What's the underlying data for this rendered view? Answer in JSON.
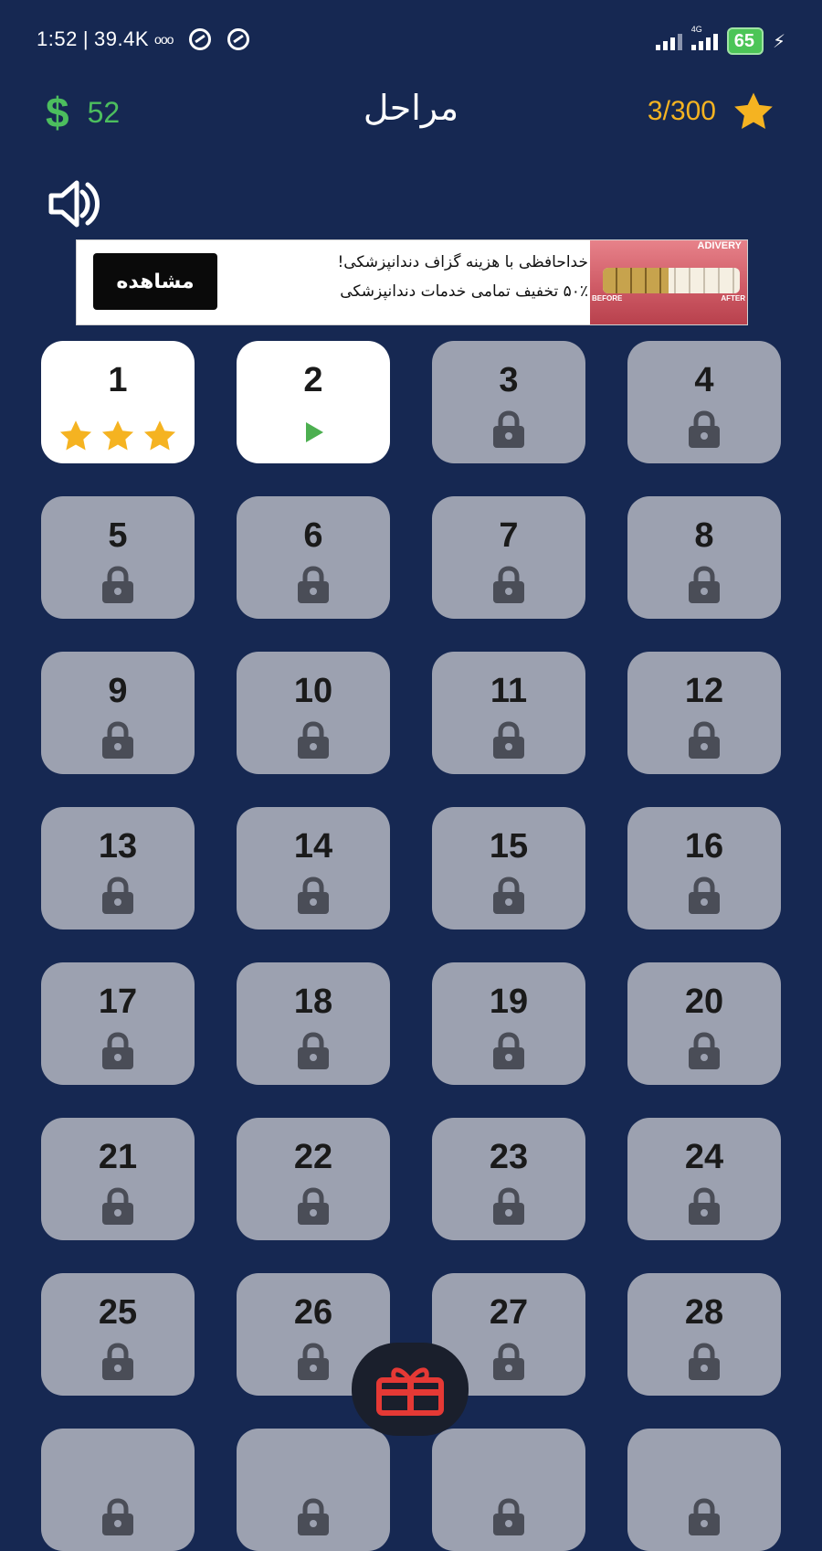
{
  "status_bar": {
    "time": "1:52",
    "separator": "|",
    "net_speed": "39.4K",
    "extra": "ooo",
    "network_type": "4G",
    "battery": "65"
  },
  "header": {
    "title": "مراحل",
    "coins": "52",
    "coins_icon": "$",
    "stars_progress": "3/300"
  },
  "ad": {
    "cta": "مشاهده",
    "line1": "خداحافظی با هزینه گزاف دندانپزشکی!",
    "line2": "۵۰٪ تخفیف تمامی خدمات دندانپزشکی",
    "brand": "ADIVERY",
    "before": "BEFORE",
    "after": "AFTER"
  },
  "levels": [
    {
      "number": "1",
      "state": "completed",
      "stars": 3
    },
    {
      "number": "2",
      "state": "current"
    },
    {
      "number": "3",
      "state": "locked"
    },
    {
      "number": "4",
      "state": "locked"
    },
    {
      "number": "5",
      "state": "locked"
    },
    {
      "number": "6",
      "state": "locked"
    },
    {
      "number": "7",
      "state": "locked"
    },
    {
      "number": "8",
      "state": "locked"
    },
    {
      "number": "9",
      "state": "locked"
    },
    {
      "number": "10",
      "state": "locked"
    },
    {
      "number": "11",
      "state": "locked"
    },
    {
      "number": "12",
      "state": "locked"
    },
    {
      "number": "13",
      "state": "locked"
    },
    {
      "number": "14",
      "state": "locked"
    },
    {
      "number": "15",
      "state": "locked"
    },
    {
      "number": "16",
      "state": "locked"
    },
    {
      "number": "17",
      "state": "locked"
    },
    {
      "number": "18",
      "state": "locked"
    },
    {
      "number": "19",
      "state": "locked"
    },
    {
      "number": "20",
      "state": "locked"
    },
    {
      "number": "21",
      "state": "locked"
    },
    {
      "number": "22",
      "state": "locked"
    },
    {
      "number": "23",
      "state": "locked"
    },
    {
      "number": "24",
      "state": "locked"
    },
    {
      "number": "25",
      "state": "locked"
    },
    {
      "number": "26",
      "state": "locked"
    },
    {
      "number": "27",
      "state": "locked"
    },
    {
      "number": "28",
      "state": "locked"
    },
    {
      "number": "",
      "state": "locked-partial"
    },
    {
      "number": "",
      "state": "locked-partial"
    },
    {
      "number": "",
      "state": "locked-partial"
    },
    {
      "number": "",
      "state": "locked-partial"
    }
  ],
  "icons": {
    "coins": "dollar-icon",
    "stars": "star-icon",
    "sound": "speaker-icon",
    "locked": "lock-icon",
    "current": "play-icon",
    "gift": "gift-icon"
  },
  "colors": {
    "background": "#162852",
    "coin_green": "#4cbe5e",
    "star_gold": "#f5b321",
    "tile_locked": "#9ca1b0",
    "tile_unlocked": "#ffffff",
    "play_green": "#4caf50",
    "gift_red": "#e53935"
  }
}
